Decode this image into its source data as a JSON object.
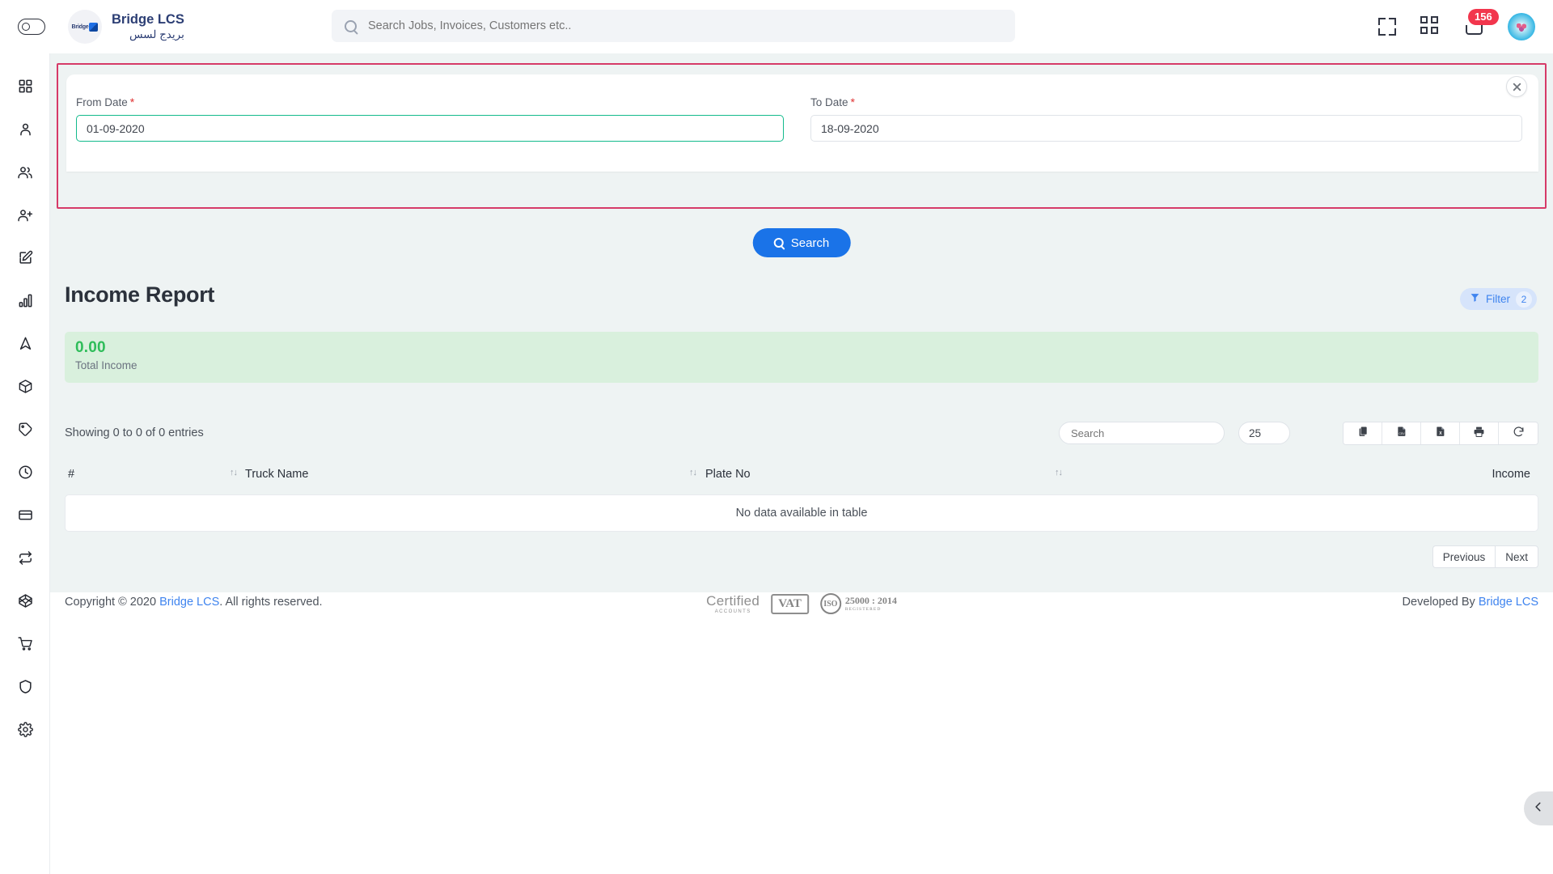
{
  "header": {
    "eye_toggle_icon": "eye-toggle-icon",
    "brand_name_en": "Bridge LCS",
    "brand_name_ar": "بريدج لسس",
    "brand_logo_text": "Bridge",
    "search": {
      "placeholder": "Search Jobs, Invoices, Customers etc..",
      "value": "",
      "icon": "search-icon"
    },
    "fullscreen_icon": "fullscreen-icon",
    "apps_icon": "grid-apps-icon",
    "notifications_icon": "notification-tray-icon",
    "notifications_count": "156",
    "avatar_icon": "user-avatar"
  },
  "sidebar": {
    "items": [
      {
        "icon": "dashboard-grid-icon",
        "name": "sidebar-item-dashboard"
      },
      {
        "icon": "user-icon",
        "name": "sidebar-item-customers"
      },
      {
        "icon": "users-icon",
        "name": "sidebar-item-employees"
      },
      {
        "icon": "user-plus-icon",
        "name": "sidebar-item-add-user"
      },
      {
        "icon": "edit-square-icon",
        "name": "sidebar-item-jobs"
      },
      {
        "icon": "bar-chart-icon",
        "name": "sidebar-item-reports"
      },
      {
        "icon": "navigation-icon",
        "name": "sidebar-item-tracking"
      },
      {
        "icon": "box-icon",
        "name": "sidebar-item-inventory"
      },
      {
        "icon": "tag-icon",
        "name": "sidebar-item-pricing"
      },
      {
        "icon": "clock-icon",
        "name": "sidebar-item-timesheet"
      },
      {
        "icon": "credit-card-icon",
        "name": "sidebar-item-payments"
      },
      {
        "icon": "repeat-icon",
        "name": "sidebar-item-transactions"
      },
      {
        "icon": "codepen-box-icon",
        "name": "sidebar-item-assets"
      },
      {
        "icon": "shopping-cart-icon",
        "name": "sidebar-item-purchase"
      },
      {
        "icon": "shield-icon",
        "name": "sidebar-item-security"
      },
      {
        "icon": "gear-icon",
        "name": "sidebar-item-settings"
      }
    ]
  },
  "filter_panel": {
    "close_icon": "close-icon",
    "from_date": {
      "label": "From Date",
      "required_mark": "*",
      "value": "01-09-2020",
      "focused": true
    },
    "to_date": {
      "label": "To Date",
      "required_mark": "*",
      "value": "18-09-2020",
      "focused": false
    },
    "search_button": {
      "label": "Search",
      "icon": "search-icon",
      "color": "#1a73e8"
    }
  },
  "report": {
    "title": "Income Report",
    "filter_pill": {
      "label": "Filter",
      "count": "2",
      "icon": "funnel-icon",
      "color": "#3f84ef"
    },
    "total_income": {
      "value": "0.00",
      "label": "Total Income",
      "value_color": "#2fbd5a",
      "card_color": "#d9f0dd"
    }
  },
  "table": {
    "showing_text": "Showing 0 to 0 of 0 entries",
    "search_placeholder": "Search",
    "search_value": "",
    "page_length": "25",
    "export_buttons": [
      {
        "name": "copy-button",
        "icon": "copy-icon"
      },
      {
        "name": "csv-button",
        "icon": "file-csv-icon"
      },
      {
        "name": "excel-button",
        "icon": "file-excel-icon"
      },
      {
        "name": "print-button",
        "icon": "printer-icon"
      },
      {
        "name": "refresh-button",
        "icon": "refresh-icon"
      }
    ],
    "columns": [
      {
        "label": "#",
        "sortable": false
      },
      {
        "label": "Truck Name",
        "sortable": true
      },
      {
        "label": "Plate No",
        "sortable": true
      },
      {
        "label": "Income",
        "sortable": true
      }
    ],
    "sort_glyph": "↑↓",
    "empty_message": "No data available in table",
    "rows": [],
    "pagination": {
      "previous_label": "Previous",
      "next_label": "Next"
    }
  },
  "footer": {
    "copyright_prefix": "Copyright © 2020 ",
    "copyright_link": "Bridge LCS",
    "copyright_suffix": ". All rights reserved.",
    "developed_prefix": "Developed By ",
    "developed_link": "Bridge LCS",
    "certifications": [
      {
        "name": "certified-accounts-logo",
        "line1": "Certified",
        "line2": "ACCOUNTS"
      },
      {
        "name": "vat-logo",
        "line1": "VAT"
      },
      {
        "name": "iso-logo",
        "seal": "ISO",
        "line1": "25000 : 2014",
        "line2": "REGISTERED"
      }
    ]
  },
  "collapse_handle": {
    "icon": "chevron-left-icon"
  }
}
